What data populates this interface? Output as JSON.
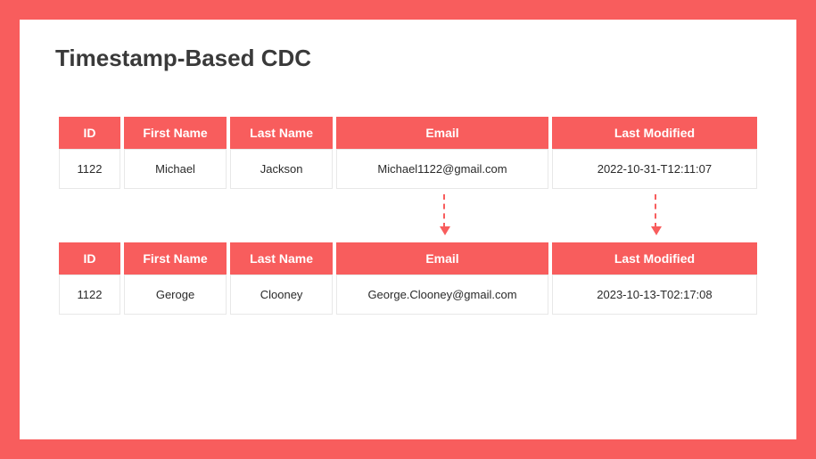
{
  "title": "Timestamp-Based CDC",
  "columns": {
    "id": "ID",
    "first_name": "First Name",
    "last_name": "Last Name",
    "email": "Email",
    "last_modified": "Last Modified"
  },
  "table_before": {
    "rows": [
      {
        "id": "1122",
        "first_name": "Michael",
        "last_name": "Jackson",
        "email": "Michael1122@gmail.com",
        "last_modified": "2022-10-31-T12:11:07"
      }
    ]
  },
  "table_after": {
    "rows": [
      {
        "id": "1122",
        "first_name": "Geroge",
        "last_name": "Clooney",
        "email": "George.Clooney@gmail.com",
        "last_modified": "2023-10-13-T02:17:08"
      }
    ]
  },
  "accent_color": "#f85d5d"
}
